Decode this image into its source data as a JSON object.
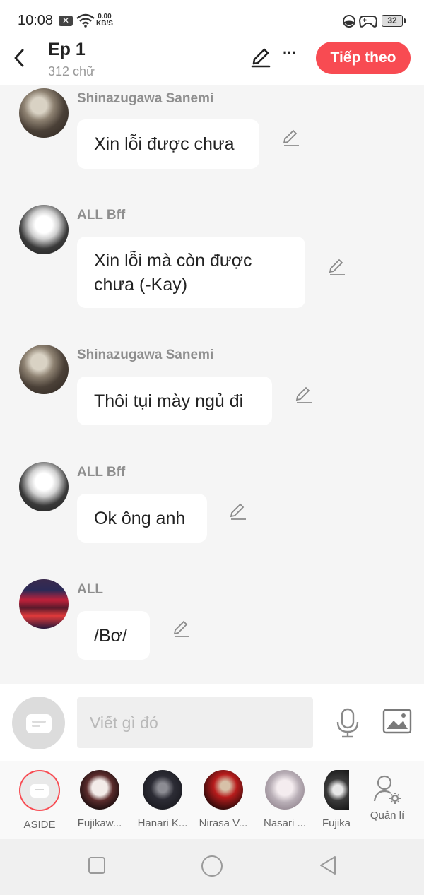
{
  "status_bar": {
    "time": "10:08",
    "notification_icon": "x-icon",
    "net_speed_value": "0.00",
    "net_speed_unit": "KB/S",
    "battery": "32"
  },
  "header": {
    "title": "Ep 1",
    "word_count": "312 chữ",
    "next_label": "Tiếp theo",
    "accent_color": "#f84b52"
  },
  "messages": [
    {
      "sender": "Shinazugawa Sanemi",
      "text": "Xin lỗi được chưa",
      "avatar": "sanemi"
    },
    {
      "sender": "ALL Bff",
      "text": "Xin lỗi mà còn được chưa (-Kay)",
      "avatar": "bff"
    },
    {
      "sender": "Shinazugawa Sanemi",
      "text": "Thôi tụi mày ngủ đi",
      "avatar": "sanemi"
    },
    {
      "sender": "ALL Bff",
      "text": "Ok ông anh",
      "avatar": "bff"
    },
    {
      "sender": "ALL",
      "text": "/Bơ/",
      "avatar": "all"
    }
  ],
  "composer": {
    "placeholder": "Viết gì đó"
  },
  "characters": [
    {
      "name": "ASIDE"
    },
    {
      "name": "Fujikaw..."
    },
    {
      "name": "Hanari K..."
    },
    {
      "name": "Nirasa V..."
    },
    {
      "name": "Nasari ..."
    },
    {
      "name": "Fujika"
    },
    {
      "name": "Quản lí"
    }
  ]
}
